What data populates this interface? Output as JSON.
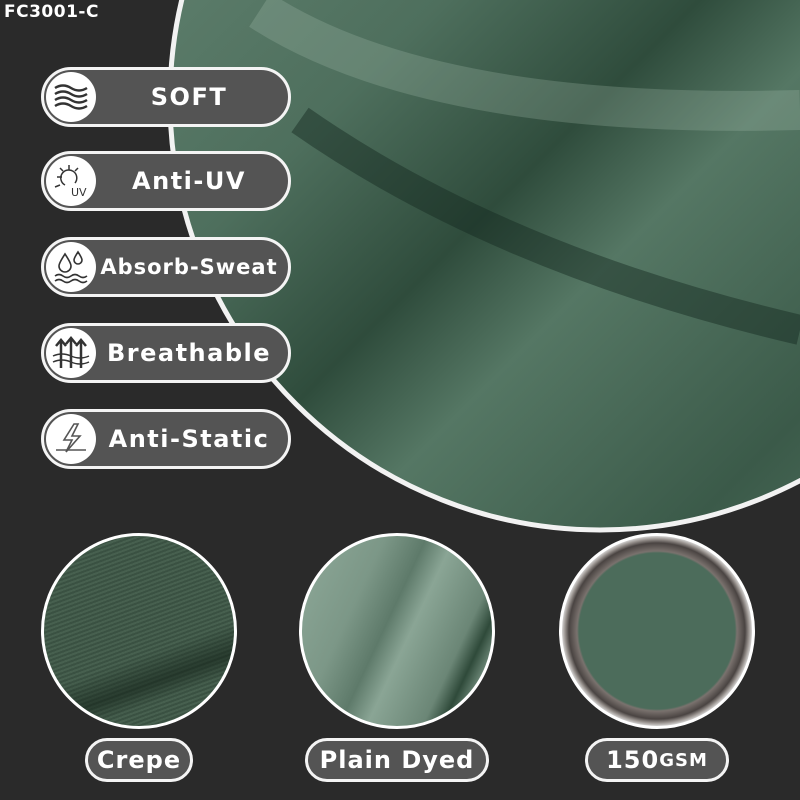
{
  "product_code": "FC3001-C",
  "features": [
    {
      "label": "SOFT",
      "icon": "waves-icon"
    },
    {
      "label": "Anti-UV",
      "icon": "sun-uv-icon",
      "icon_text": "UV"
    },
    {
      "label": "Absorb-Sweat",
      "icon": "water-drops-icon"
    },
    {
      "label": "Breathable",
      "icon": "arrows-up-icon"
    },
    {
      "label": "Anti-Static",
      "icon": "lightning-icon"
    }
  ],
  "details": [
    {
      "label": "Crepe"
    },
    {
      "label": "Plain Dyed"
    },
    {
      "weight": "150",
      "unit": "GSM"
    }
  ],
  "colors": {
    "background": "#2a2a2a",
    "pill": "#545454",
    "fabric": "#4a6b59"
  }
}
